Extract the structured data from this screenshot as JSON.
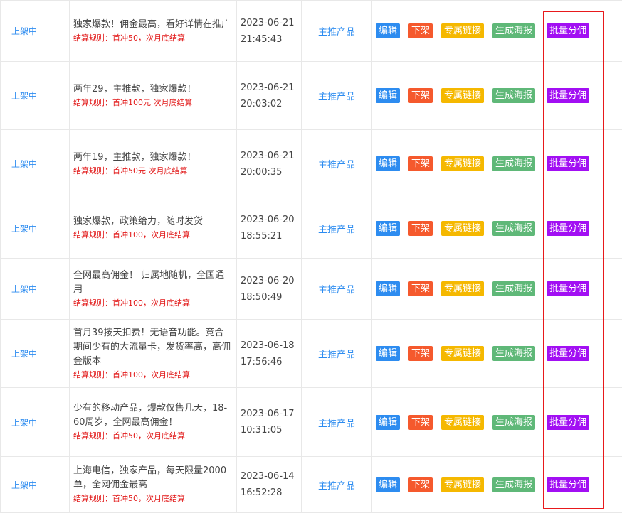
{
  "rows": [
    {
      "status": "上架中",
      "title": "独家爆款！佣金最高，看好详情在推广",
      "rule": "结算规则：首冲50，次月底结算",
      "date": "2023-06-21 21:45:43",
      "type": "主推产品"
    },
    {
      "status": "上架中",
      "title": "两年29，主推款，独家爆款！",
      "rule": "结算规则：首冲100元 次月底结算",
      "date": "2023-06-21 20:03:02",
      "type": "主推产品"
    },
    {
      "status": "上架中",
      "title": "两年19，主推款，独家爆款！",
      "rule": "结算规则：首冲50元 次月底结算",
      "date": "2023-06-21 20:00:35",
      "type": "主推产品"
    },
    {
      "status": "上架中",
      "title": "独家爆款，政策给力，随时发货",
      "rule": "结算规则：首冲100，次月底结算",
      "date": "2023-06-20 18:55:21",
      "type": "主推产品"
    },
    {
      "status": "上架中",
      "title": "全网最高佣金！ 归属地随机，全国通用",
      "rule": "结算规则：首冲100，次月底结算",
      "date": "2023-06-20 18:50:49",
      "type": "主推产品"
    },
    {
      "status": "上架中",
      "title": "首月39按天扣费！无语音功能。竞合期间少有的大流量卡，发货率高，高佣金版本",
      "rule": "结算规则：首冲100，次月底结算",
      "date": "2023-06-18 17:56:46",
      "type": "主推产品"
    },
    {
      "status": "上架中",
      "title": "少有的移动产品，爆款仅售几天，18-60周岁，全网最高佣金！",
      "rule": "结算规则：首冲50，次月底结算",
      "date": "2023-06-17 10:31:05",
      "type": "主推产品"
    },
    {
      "status": "上架中",
      "title": "上海电信，独家产品，每天限量2000单，全网佣金最高",
      "rule": "结算规则：首冲50，次月底结算",
      "date": "2023-06-14 16:52:28",
      "type": "主推产品"
    }
  ],
  "actions": {
    "edit": "编辑",
    "down": "下架",
    "link": "专属链接",
    "poster": "生成海报",
    "batch": "批量分佣"
  },
  "colors": {
    "edit": "#2d8cf0",
    "down": "#f5592d",
    "link": "#f5b800",
    "poster": "#5fb878",
    "batch": "#a20ff3",
    "highlight": "#e8191b"
  }
}
